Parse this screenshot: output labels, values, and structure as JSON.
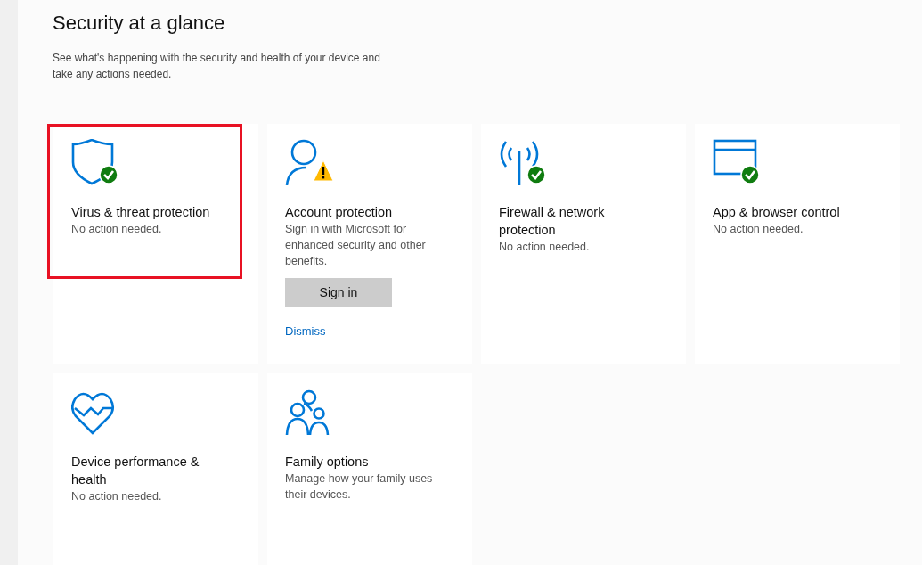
{
  "page": {
    "title": "Security at a glance",
    "description": "See what's happening with the security and health of your device and take any actions needed."
  },
  "tiles": [
    {
      "kind": "shield",
      "ok": true,
      "warning": false,
      "highlighted": true,
      "title": "Virus & threat protection",
      "status": "No action needed."
    },
    {
      "kind": "person",
      "ok": false,
      "warning": true,
      "highlighted": false,
      "title": "Account protection",
      "status": "Sign in with Microsoft for enhanced security and other benefits.",
      "button": "Sign in",
      "link": "Dismiss"
    },
    {
      "kind": "antenna",
      "ok": true,
      "warning": false,
      "highlighted": false,
      "title": "Firewall & network protection",
      "status": "No action needed."
    },
    {
      "kind": "window",
      "ok": true,
      "warning": false,
      "highlighted": false,
      "title": "App & browser control",
      "status": "No action needed."
    },
    {
      "kind": "heart",
      "ok": false,
      "warning": false,
      "highlighted": false,
      "title": "Device performance & health",
      "status": "No action needed."
    },
    {
      "kind": "family",
      "ok": false,
      "warning": false,
      "highlighted": false,
      "title": "Family options",
      "status": "Manage how your family uses their devices."
    }
  ]
}
